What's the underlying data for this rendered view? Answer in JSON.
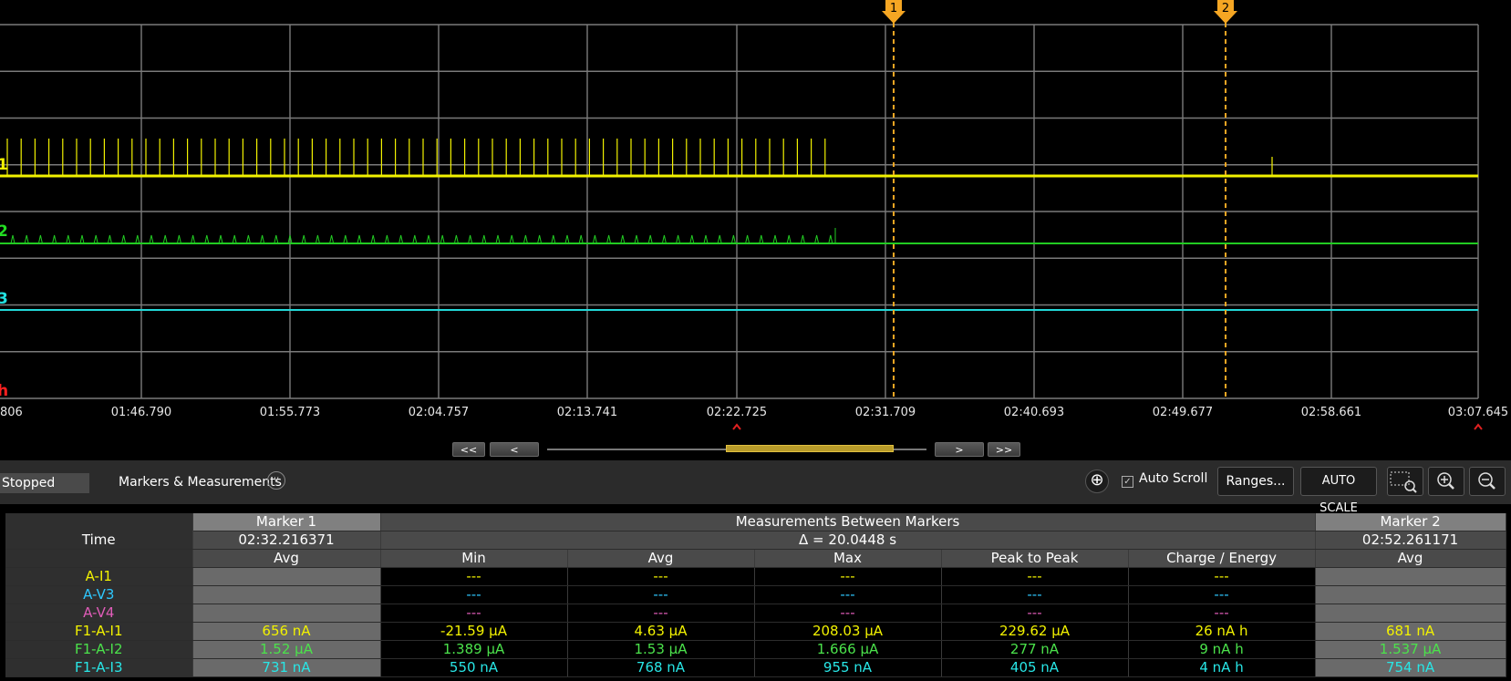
{
  "plot": {
    "channel_labels": [
      {
        "text": "1",
        "color": "#f2f200"
      },
      {
        "text": "2",
        "color": "#22dd22"
      },
      {
        "text": "3",
        "color": "#22e0e0"
      },
      {
        "text": "h",
        "color": "#ff2020"
      }
    ],
    "x_ticks": [
      "806",
      "01:46.790",
      "01:55.773",
      "02:04.757",
      "02:13.741",
      "02:22.725",
      "02:31.709",
      "02:40.693",
      "02:49.677",
      "02:58.661",
      "03:07.645"
    ],
    "markers": [
      {
        "label": "1"
      },
      {
        "label": "2"
      }
    ],
    "colors": {
      "grid": "#7a7a7a",
      "trace1": "#f2f200",
      "trace2": "#22cc22",
      "trace3": "#22d8d8",
      "marker": "#f5a623"
    }
  },
  "nav": {
    "first": "<<",
    "prev": "<",
    "next": ">",
    "last": ">>"
  },
  "toolbar": {
    "status": "Stopped",
    "markers_measurements": "Markers & Measurements",
    "add_icon": "crosshair-plus-icon",
    "auto_scroll": "Auto Scroll",
    "auto_scroll_checked": true,
    "ranges": "Ranges...",
    "auto_scale": "AUTO SCALE",
    "zoom_box_icon": "zoom-box-icon",
    "zoom_in_icon": "zoom-in-icon",
    "zoom_out_icon": "zoom-out-icon"
  },
  "table": {
    "time_label": "Time",
    "marker1": {
      "title": "Marker 1",
      "time": "02:32.216371",
      "col": "Avg"
    },
    "between": {
      "title": "Measurements Between Markers",
      "delta": "Δ = 20.0448 s",
      "cols": [
        "Min",
        "Avg",
        "Max",
        "Peak to Peak",
        "Charge / Energy"
      ]
    },
    "marker2": {
      "title": "Marker 2",
      "time": "02:52.261171",
      "col": "Avg"
    },
    "rows": [
      {
        "name": "A-I1",
        "color": "#f2f200",
        "m1": "",
        "vals": [
          "---",
          "---",
          "---",
          "---",
          "---"
        ],
        "m2": ""
      },
      {
        "name": "A-V3",
        "color": "#2ec8ff",
        "m1": "",
        "vals": [
          "---",
          "---",
          "---",
          "---",
          "---"
        ],
        "m2": ""
      },
      {
        "name": "A-V4",
        "color": "#e05cb8",
        "m1": "",
        "vals": [
          "---",
          "---",
          "---",
          "---",
          "---"
        ],
        "m2": ""
      },
      {
        "name": "F1-A-I1",
        "color": "#f2f200",
        "m1": "656 nA",
        "vals": [
          "-21.59 µA",
          "4.63 µA",
          "208.03 µA",
          "229.62 µA",
          "26 nA h"
        ],
        "m2": "681 nA"
      },
      {
        "name": "F1-A-I2",
        "color": "#4be24b",
        "m1": "1.52 µA",
        "vals": [
          "1.389 µA",
          "1.53 µA",
          "1.666 µA",
          "277 nA",
          "9 nA h"
        ],
        "m2": "1.537 µA"
      },
      {
        "name": "F1-A-I3",
        "color": "#28e6e6",
        "m1": "731 nA",
        "vals": [
          "550 nA",
          "768 nA",
          "955 nA",
          "405 nA",
          "4 nA h"
        ],
        "m2": "754 nA"
      }
    ]
  }
}
